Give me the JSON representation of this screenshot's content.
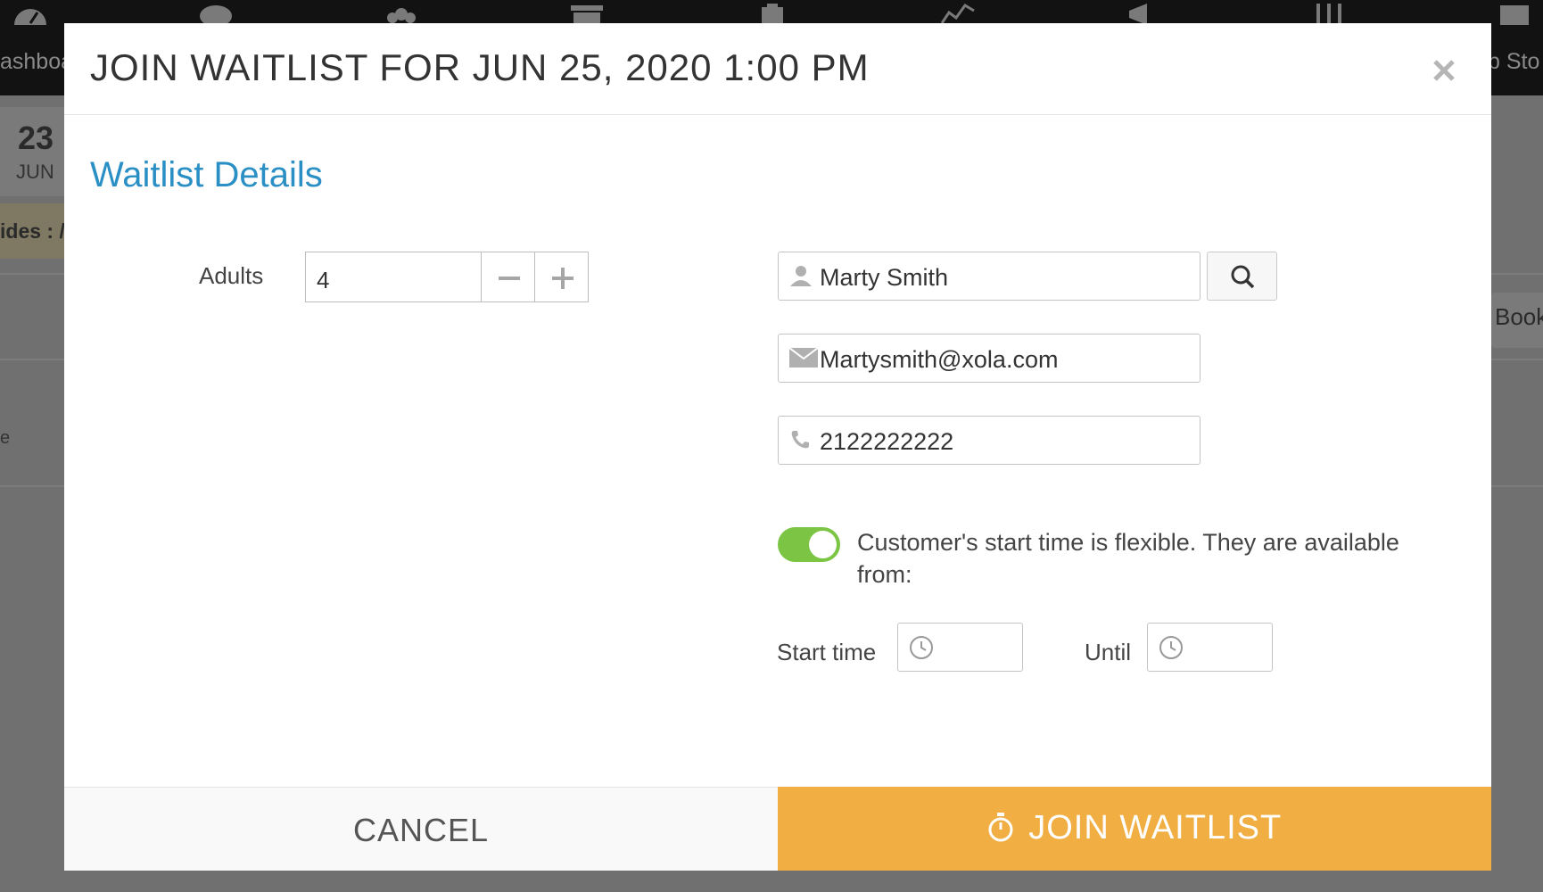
{
  "background": {
    "nav_labels": [
      "ashboa",
      "p Sto"
    ],
    "date_day": "23",
    "date_month": "JUN",
    "banner_text": "ides : /",
    "book_label": "Book",
    "fragment": "e"
  },
  "modal": {
    "title": "JOIN WAITLIST FOR JUN 25, 2020 1:00 PM",
    "section_title": "Waitlist Details",
    "adults": {
      "label": "Adults",
      "value": "4"
    },
    "customer": {
      "name": "Marty Smith",
      "email": "Martysmith@xola.com",
      "phone": "2122222222"
    },
    "flexible": {
      "enabled": true,
      "text": "Customer's start time is flexible. They are available from:",
      "start_label": "Start time",
      "until_label": "Until"
    },
    "footer": {
      "cancel_label": "CANCEL",
      "join_label": "JOIN WAITLIST"
    }
  },
  "colors": {
    "accent_blue": "#2a8fc4",
    "join_orange": "#f0ae43",
    "toggle_green": "#7cc544"
  },
  "icons": [
    "close-icon",
    "minus-icon",
    "plus-icon",
    "user-icon",
    "search-icon",
    "envelope-icon",
    "phone-icon",
    "clock-icon",
    "stopwatch-icon"
  ]
}
